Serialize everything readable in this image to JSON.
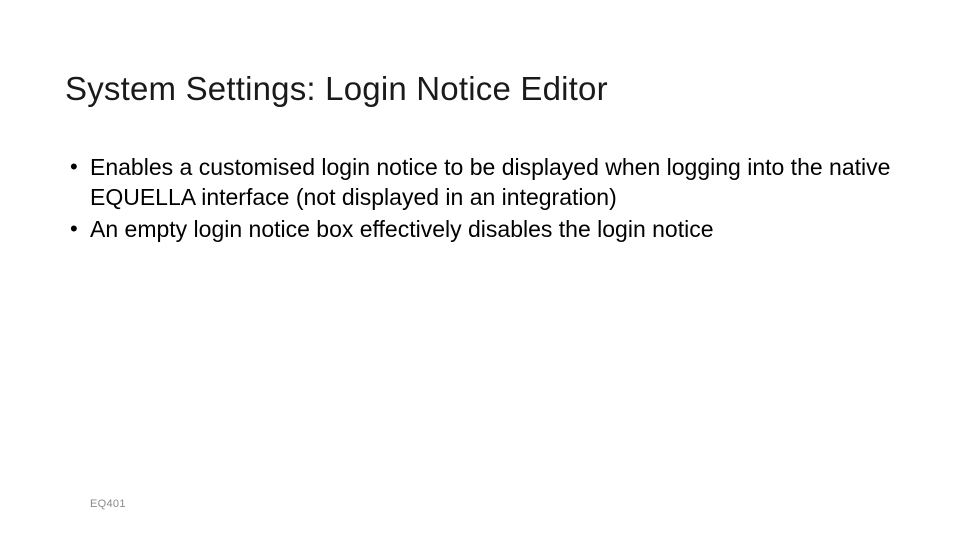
{
  "slide": {
    "title": "System Settings: Login Notice Editor",
    "bullets": [
      "Enables a customised login notice to be displayed when logging into the native EQUELLA interface (not displayed in an integration)",
      "An empty login notice box effectively disables the login notice"
    ],
    "footer": "EQ401"
  }
}
